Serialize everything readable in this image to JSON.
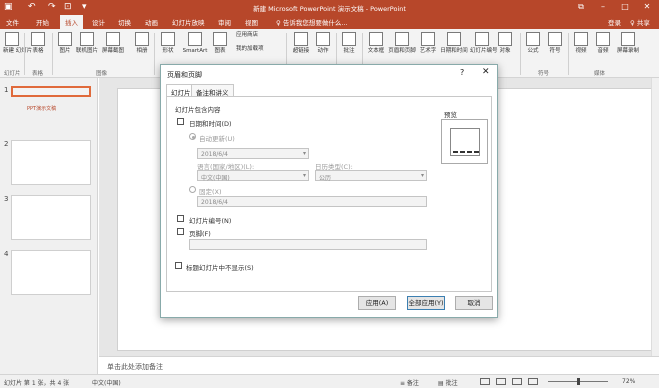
{
  "titlebar": {
    "title": "新建 Microsoft PowerPoint 演示文稿 - PowerPoint",
    "undo": "↶",
    "redo": "↷",
    "start": "⊡",
    "qat_more": "▾",
    "restore": "⧉",
    "minimize": "–",
    "maximize": "□",
    "close": "✕"
  },
  "tabs": [
    "文件",
    "开始",
    "插入",
    "设计",
    "切换",
    "动画",
    "幻灯片放映",
    "审阅",
    "视图"
  ],
  "active_tab": "插入",
  "tell_me": "♀ 告诉我您想要做什么...",
  "account": {
    "login": "登录",
    "share": "♀ 共享"
  },
  "ribbon": {
    "buttons": [
      {
        "label": "新建\n幻灯片"
      },
      {
        "label": "表格"
      },
      {
        "label": "图片"
      },
      {
        "label": "联机图片"
      },
      {
        "label": "屏幕截图"
      },
      {
        "label": "相册"
      },
      {
        "label": "形状"
      },
      {
        "label": "SmartArt"
      },
      {
        "label": "图表"
      },
      {
        "label": "应用商店"
      },
      {
        "label": "我的加载项"
      },
      {
        "label": "超链接"
      },
      {
        "label": "动作"
      },
      {
        "label": "批注"
      },
      {
        "label": "文本框"
      },
      {
        "label": "页眉和页脚"
      },
      {
        "label": "艺术字"
      },
      {
        "label": "日期和时间"
      },
      {
        "label": "幻灯片编号"
      },
      {
        "label": "对象"
      },
      {
        "label": "公式"
      },
      {
        "label": "符号"
      },
      {
        "label": "视频"
      },
      {
        "label": "音频"
      },
      {
        "label": "屏幕录制"
      }
    ],
    "groups": [
      "幻灯片",
      "表格",
      "图像",
      "符号",
      "媒体"
    ]
  },
  "slides": {
    "numbers": [
      "1",
      "2",
      "3",
      "4"
    ],
    "first_title": "PPT演示文稿"
  },
  "notes_placeholder": "单击此处添加备注",
  "status": {
    "slide": "幻灯片 第 1 张，共 4 张",
    "lang": "中文(中国)",
    "notes": "≡ 备注",
    "comments": "▤ 批注",
    "zoom": "72%"
  },
  "dialog": {
    "title": "页眉和页脚",
    "help": "?",
    "close": "✕",
    "tabs": [
      "幻灯片",
      "备注和讲义"
    ],
    "group_label": "幻灯片包含内容",
    "date_time": "日期和时间(D)",
    "auto_update": "自动更新(U)",
    "date_value": "2018/6/4",
    "language_label": "语言(国家/地区)(L):",
    "language_value": "中文(中国)",
    "calendar_label": "日历类型(C):",
    "calendar_value": "公历",
    "fixed": "固定(X)",
    "fixed_value": "2018/6/4",
    "slide_number": "幻灯片编号(N)",
    "footer": "页脚(F)",
    "hide_title": "标题幻灯片中不显示(S)",
    "preview": "预览",
    "apply": "应用(A)",
    "apply_all": "全部应用(Y)",
    "cancel": "取消"
  }
}
